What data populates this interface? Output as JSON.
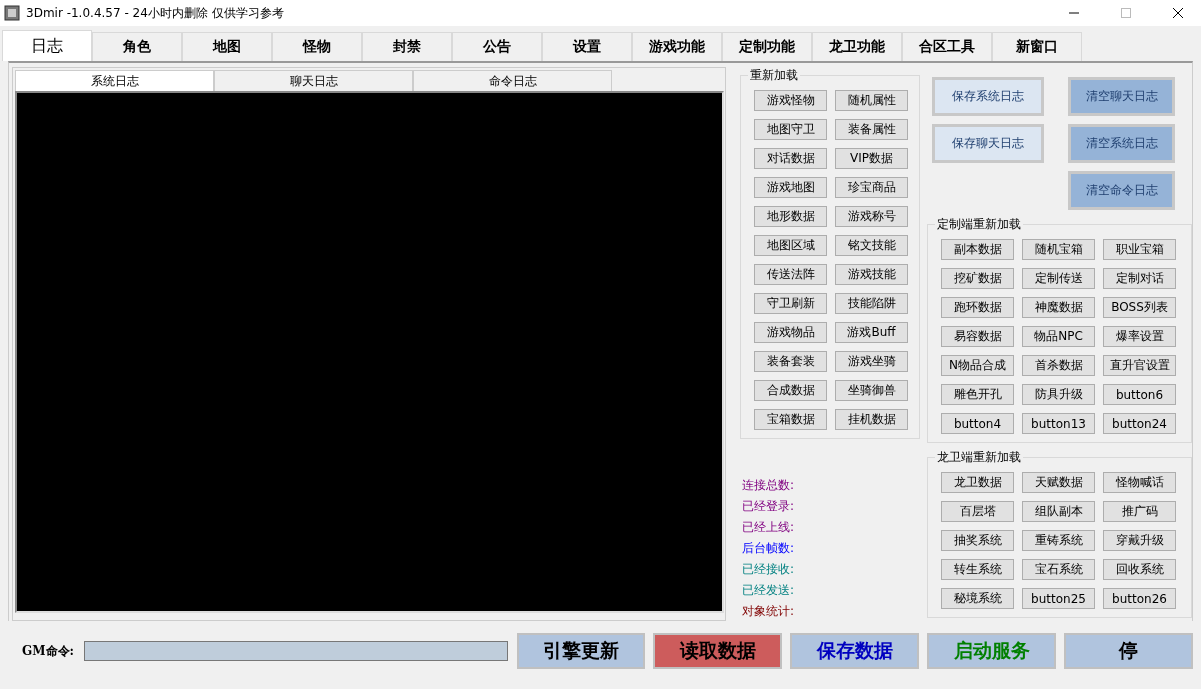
{
  "window": {
    "title": "3Dmir -1.0.4.57 - 24小时内删除  仅供学习参考"
  },
  "tabs": [
    {
      "label": "日志",
      "selected": true
    },
    {
      "label": "角色",
      "selected": false
    },
    {
      "label": "地图",
      "selected": false
    },
    {
      "label": "怪物",
      "selected": false
    },
    {
      "label": "封禁",
      "selected": false
    },
    {
      "label": "公告",
      "selected": false
    },
    {
      "label": "设置",
      "selected": false
    },
    {
      "label": "游戏功能",
      "selected": false
    },
    {
      "label": "定制功能",
      "selected": false
    },
    {
      "label": "龙卫功能",
      "selected": false
    },
    {
      "label": "合区工具",
      "selected": false
    },
    {
      "label": "新窗口",
      "selected": false
    }
  ],
  "log_tabs": [
    {
      "label": "系统日志",
      "selected": true
    },
    {
      "label": "聊天日志",
      "selected": false
    },
    {
      "label": "命令日志",
      "selected": false
    }
  ],
  "reload_group": {
    "title": "重新加载",
    "buttons": [
      "游戏怪物",
      "随机属性",
      "地图守卫",
      "装备属性",
      "对话数据",
      "VIP数据",
      "游戏地图",
      "珍宝商品",
      "地形数据",
      "游戏称号",
      "地图区域",
      "铭文技能",
      "传送法阵",
      "游戏技能",
      "守卫刷新",
      "技能陷阱",
      "游戏物品",
      "游戏Buff",
      "装备套装",
      "游戏坐骑",
      "合成数据",
      "坐骑御兽",
      "宝箱数据",
      "挂机数据"
    ]
  },
  "log_buttons": [
    {
      "label": "保存系统日志",
      "kind": "save"
    },
    {
      "label": "清空聊天日志",
      "kind": "clear"
    },
    {
      "label": "保存聊天日志",
      "kind": "save"
    },
    {
      "label": "清空系统日志",
      "kind": "clear"
    },
    {
      "label": "清空命令日志",
      "kind": "clear"
    }
  ],
  "custom_group": {
    "title": "定制端重新加载",
    "buttons": [
      "副本数据",
      "随机宝箱",
      "职业宝箱",
      "挖矿数据",
      "定制传送",
      "定制对话",
      "跑环数据",
      "神魔数据",
      "BOSS列表",
      "易容数据",
      "物品NPC",
      "爆率设置",
      "N物品合成",
      "首杀数据",
      "直升官设置",
      "雕色开孔",
      "防具升级",
      "button6",
      "button4",
      "button13",
      "button24"
    ]
  },
  "stats": [
    {
      "label": "连接总数:",
      "kind": "session"
    },
    {
      "label": "已经登录:",
      "kind": "session"
    },
    {
      "label": "已经上线:",
      "kind": "session"
    },
    {
      "label": "后台帧数:",
      "kind": "frame"
    },
    {
      "label": "已经接收:",
      "kind": "traffic"
    },
    {
      "label": "已经发送:",
      "kind": "traffic"
    },
    {
      "label": "对象统计:",
      "kind": "objects"
    }
  ],
  "dragon_group": {
    "title": "龙卫端重新加载",
    "buttons": [
      "龙卫数据",
      "天赋数据",
      "怪物喊话",
      "百层塔",
      "组队副本",
      "推广码",
      "抽奖系统",
      "重铸系统",
      "穿戴升级",
      "转生系统",
      "宝石系统",
      "回收系统",
      "秘境系统",
      "button25",
      "button26"
    ]
  },
  "gm": {
    "label": "GM命令:"
  },
  "actions": [
    {
      "label": "引擎更新",
      "kind": "update"
    },
    {
      "label": "读取数据",
      "kind": "read"
    },
    {
      "label": "保存数据",
      "kind": "save"
    },
    {
      "label": "启动服务",
      "kind": "start"
    },
    {
      "label": "停",
      "kind": "stop"
    }
  ]
}
